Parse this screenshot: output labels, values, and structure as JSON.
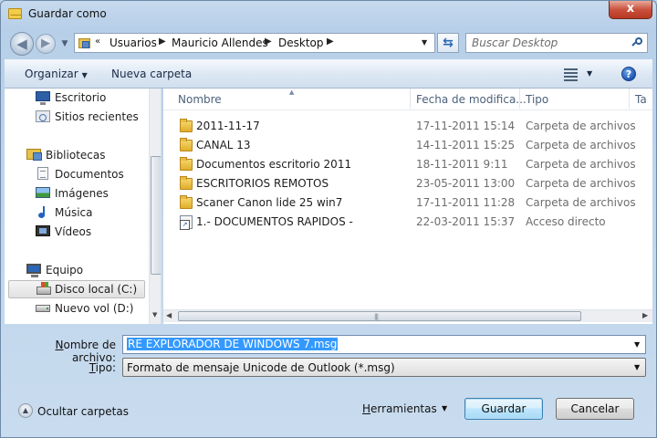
{
  "window": {
    "title": "Guardar como",
    "close_label": "x"
  },
  "nav": {
    "breadcrumbs": [
      "Usuarios",
      "Mauricio Allendes",
      "Desktop"
    ],
    "overflow_chevron": "«",
    "search_placeholder": "Buscar Desktop"
  },
  "toolbar": {
    "organize_label": "Organizar",
    "new_folder_label": "Nueva carpeta",
    "help_label": "?"
  },
  "sidebar": {
    "favorites": [
      {
        "label": "Escritorio",
        "icon": "desktop-icon"
      },
      {
        "label": "Sitios recientes",
        "icon": "recent-places-icon"
      }
    ],
    "libraries_label": "Bibliotecas",
    "libraries": [
      {
        "label": "Documentos",
        "icon": "documents-icon"
      },
      {
        "label": "Imágenes",
        "icon": "pictures-icon"
      },
      {
        "label": "Música",
        "icon": "music-icon"
      },
      {
        "label": "Vídeos",
        "icon": "videos-icon"
      }
    ],
    "computer_label": "Equipo",
    "drives": [
      {
        "label": "Disco local (C:)",
        "icon": "local-disk-icon",
        "selected": true
      },
      {
        "label": "Nuevo vol (D:)",
        "icon": "drive-icon",
        "selected": false
      }
    ]
  },
  "files": {
    "columns": {
      "name": "Nombre",
      "date": "Fecha de modifica...",
      "type": "Tipo",
      "size": "Ta"
    },
    "rows": [
      {
        "name": "2011-11-17",
        "date": "17-11-2011 15:14",
        "type": "Carpeta de archivos",
        "icon": "folder-icon"
      },
      {
        "name": "CANAL 13",
        "date": "14-11-2011 15:25",
        "type": "Carpeta de archivos",
        "icon": "folder-icon"
      },
      {
        "name": "Documentos escritorio 2011",
        "date": "18-11-2011 9:11",
        "type": "Carpeta de archivos",
        "icon": "folder-icon"
      },
      {
        "name": "ESCRITORIOS REMOTOS",
        "date": "23-05-2011 13:00",
        "type": "Carpeta de archivos",
        "icon": "folder-icon"
      },
      {
        "name": "Scaner Canon lide 25 win7",
        "date": "17-11-2011 11:28",
        "type": "Carpeta de archivos",
        "icon": "folder-icon"
      },
      {
        "name": "1.- DOCUMENTOS RAPIDOS -",
        "date": "22-03-2011 15:37",
        "type": "Acceso directo",
        "icon": "shortcut-icon"
      }
    ]
  },
  "form": {
    "filename_label_accel": "N",
    "filename_label_rest": "ombre de archivo:",
    "filename_value": "RE EXPLORADOR DE WINDOWS 7.msg",
    "type_label_accel": "T",
    "type_label_rest": "ipo:",
    "type_value": "Formato de mensaje Unicode de Outlook (*.msg)"
  },
  "footer": {
    "hide_folders_label": "Ocultar carpetas",
    "tools_accel": "H",
    "tools_rest": "erramientas",
    "save_label": "Guardar",
    "cancel_label": "Cancelar"
  }
}
